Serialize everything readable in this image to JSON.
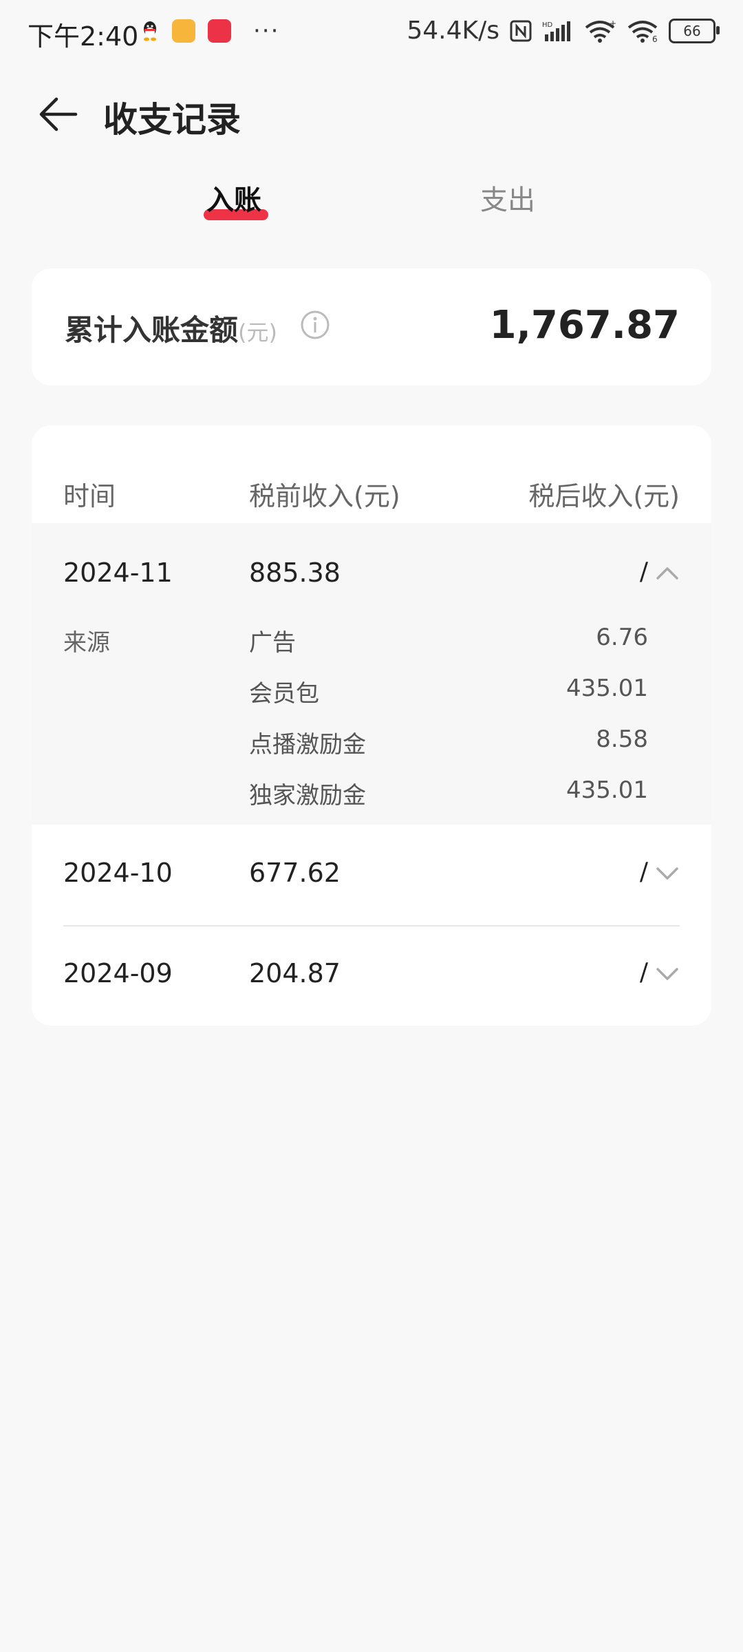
{
  "status_bar": {
    "time": "下午2:40",
    "net_speed": "54.4K/s",
    "battery": "66"
  },
  "header": {
    "title": "收支记录"
  },
  "tabs": [
    {
      "label": "入账",
      "active": true
    },
    {
      "label": "支出",
      "active": false
    }
  ],
  "summary": {
    "label": "累计入账金额",
    "unit": "(元)",
    "amount": "1,767.87"
  },
  "table": {
    "headers": {
      "time": "时间",
      "pre_tax": "税前收入(元)",
      "post_tax": "税后收入(元)"
    },
    "rows": [
      {
        "month": "2024-11",
        "pre_tax": "885.38",
        "post_tax": "/",
        "expanded": true,
        "source_label": "来源",
        "sources": [
          {
            "name": "广告",
            "value": "6.76"
          },
          {
            "name": "会员包",
            "value": "435.01"
          },
          {
            "name": "点播激励金",
            "value": "8.58"
          },
          {
            "name": "独家激励金",
            "value": "435.01"
          }
        ]
      },
      {
        "month": "2024-10",
        "pre_tax": "677.62",
        "post_tax": "/",
        "expanded": false
      },
      {
        "month": "2024-09",
        "pre_tax": "204.87",
        "post_tax": "/",
        "expanded": false
      }
    ]
  },
  "colors": {
    "accent": "#ee3347",
    "background": "#f8f8f8",
    "card": "#ffffff"
  },
  "icons": [
    "back-arrow-icon",
    "info-icon",
    "chevron-up-icon",
    "chevron-down-icon"
  ]
}
